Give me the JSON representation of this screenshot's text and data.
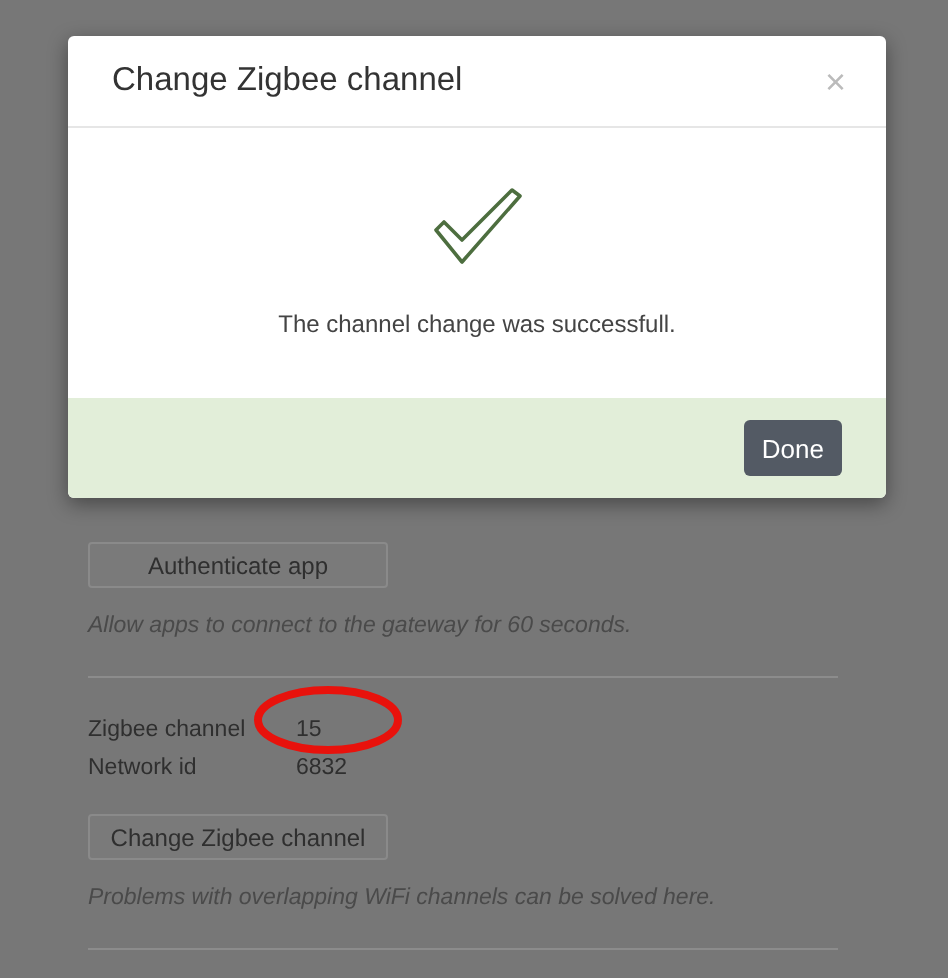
{
  "page": {
    "auth_button": "Authenticate app",
    "auth_hint": "Allow apps to connect to the gateway for 60 seconds.",
    "fields": [
      {
        "label": "Zigbee channel",
        "value": "15"
      },
      {
        "label": "Network id",
        "value": "6832"
      }
    ],
    "channel_button": "Change Zigbee channel",
    "channel_hint": "Problems with overlapping WiFi channels can be solved here."
  },
  "dialog": {
    "title": "Change Zigbee channel",
    "close": "×",
    "message": "The channel change was successfull.",
    "button": "Done"
  }
}
